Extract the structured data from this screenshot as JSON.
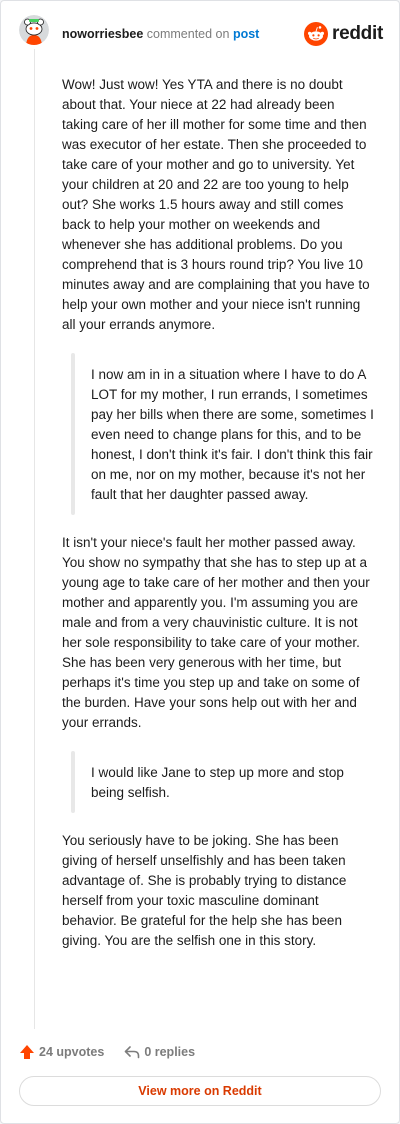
{
  "header": {
    "username": "noworriesbee",
    "action_text": "commented on",
    "post_link": "post",
    "brand": "reddit"
  },
  "colors": {
    "brand_orange": "#ff4500",
    "link_blue": "#0079d3",
    "upvote": "#ff4500",
    "view_more_text": "#d93a00"
  },
  "icons": {
    "avatar": "snoo-avatar-icon",
    "brand": "reddit-logo-icon",
    "upvote": "upvote-arrow-icon",
    "reply": "reply-arrow-icon"
  },
  "comment": {
    "p1": "Wow! Just wow! Yes YTA and there is no doubt about that. Your niece at 22 had already been taking care of her ill mother for some time and then was executor of her estate. Then she proceeded to take care of your mother and go to university. Yet your children at 20 and 22 are too young to help out? She works 1.5 hours away and still comes back to help your mother on weekends and whenever she has additional problems. Do you comprehend that is 3 hours round trip? You live 10 minutes away and are complaining that you have to help your own mother and your niece isn't running all your errands anymore.",
    "quote1": "I now am in in a situation where I have to do A LOT for my mother, I run errands, I sometimes pay her bills when there are some, sometimes I even need to change plans for this, and to be honest, I don't think it's fair. I don't think this fair on me, nor on my mother, because it's not her fault that her daughter passed away.",
    "p2": "It isn't your niece's fault her mother passed away. You show no sympathy that she has to step up at a young age to take care of her mother and then your mother and apparently you. I'm assuming you are male and from a very chauvinistic culture. It is not her sole responsibility to take care of your mother. She has been very generous with her time, but perhaps it's time you step up and take on some of the burden. Have your sons help out with her and your errands.",
    "quote2": "I would like Jane to step up more and stop being selfish.",
    "p3": "You seriously have to be joking. She has been giving of herself unselfishly and has been taken advantage of. She is probably trying to distance herself from your toxic masculine dominant behavior. Be grateful for the help she has been giving. You are the selfish one in this story."
  },
  "actions": {
    "upvotes": "24 upvotes",
    "replies": "0 replies"
  },
  "view_more": "View more on Reddit"
}
